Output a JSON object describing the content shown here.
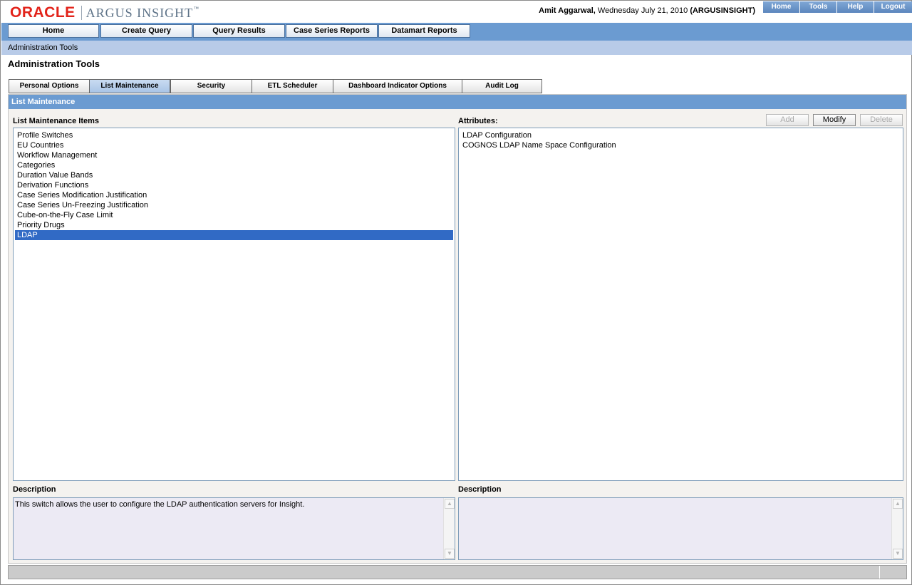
{
  "header": {
    "logo_oracle": "ORACLE",
    "logo_product": "ARGUS INSIGHT",
    "logo_tm": "™",
    "user_name": "Amit Aggarwal,",
    "date_text": " Wednesday July 21, 2010 ",
    "database": "(ARGUSINSIGHT)",
    "top_links": [
      "Home",
      "Tools",
      "Help",
      "Logout"
    ]
  },
  "nav": {
    "items": [
      "Home",
      "Create Query",
      "Query Results",
      "Case Series Reports",
      "Datamart Reports"
    ]
  },
  "breadcrumb": "Administration Tools",
  "page_title": "Administration Tools",
  "tabs": {
    "items": [
      "Personal Options",
      "List Maintenance",
      "Security",
      "ETL Scheduler",
      "Dashboard Indicator Options",
      "Audit Log"
    ],
    "active": "List Maintenance"
  },
  "panel": {
    "title": "List Maintenance",
    "items_label": "List Maintenance Items",
    "items": [
      "Profile Switches",
      "EU Countries",
      "Workflow Management",
      "Categories",
      "Duration Value Bands",
      "Derivation Functions",
      "Case Series Modification Justification",
      "Case Series Un-Freezing Justification",
      "Cube-on-the-Fly Case Limit",
      "Priority Drugs",
      "LDAP"
    ],
    "selected_item": "LDAP",
    "attributes_label": "Attributes:",
    "buttons": {
      "add": "Add",
      "modify": "Modify",
      "delete": "Delete"
    },
    "attributes": [
      "LDAP Configuration",
      "COGNOS LDAP Name Space Configuration"
    ],
    "left_description_label": "Description",
    "left_description": "This switch allows the user to configure the LDAP authentication servers for Insight.",
    "right_description_label": "Description",
    "right_description": ""
  },
  "colors": {
    "nav_blue": "#6b9bd1",
    "breadcrumb_blue": "#b8cbe8",
    "selection_blue": "#316ac5",
    "oracle_red": "#e2231a"
  }
}
